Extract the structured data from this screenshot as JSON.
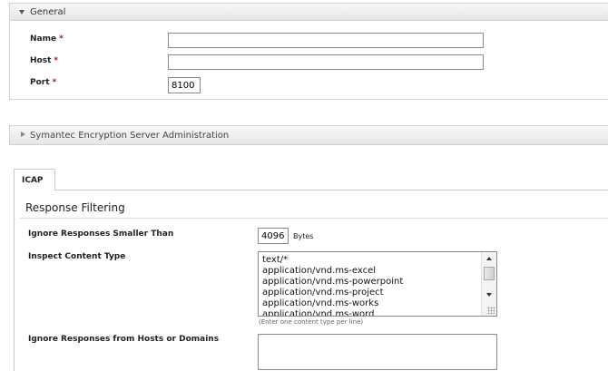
{
  "general": {
    "title": "General",
    "fields": {
      "name": {
        "label": "Name",
        "required": "*",
        "value": ""
      },
      "host": {
        "label": "Host",
        "required": "*",
        "value": ""
      },
      "port": {
        "label": "Port",
        "required": "*",
        "value": "8100"
      }
    }
  },
  "symantec": {
    "title": "Symantec Encryption Server Administration"
  },
  "tabs": [
    {
      "label": "ICAP"
    }
  ],
  "icap": {
    "section_title": "Response Filtering",
    "ignore_smaller": {
      "label": "Ignore Responses Smaller Than",
      "value": "4096",
      "unit": "Bytes"
    },
    "inspect_content_type": {
      "label": "Inspect Content Type",
      "items": [
        "text/*",
        "application/vnd.ms-excel",
        "application/vnd.ms-powerpoint",
        "application/vnd.ms-project",
        "application/vnd.ms-works",
        "application/vnd.ms-word"
      ],
      "hint": "(Enter one content type per line)"
    },
    "ignore_hosts": {
      "label": "Ignore Responses from Hosts or Domains",
      "value": ""
    }
  },
  "icons": {
    "general_toggle": "triangle-down-icon",
    "symantec_toggle": "triangle-right-icon"
  }
}
